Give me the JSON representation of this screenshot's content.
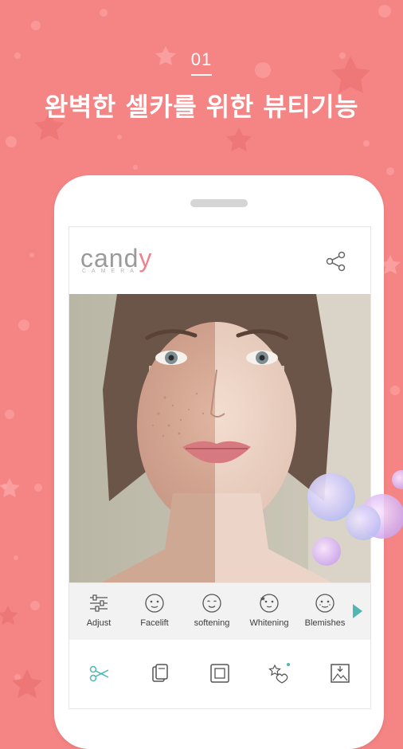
{
  "header": {
    "step": "01",
    "headline": "완벽한 셀카를 위한 뷰티기능"
  },
  "app": {
    "logo_main_prefix": "cand",
    "logo_main_suffix": "y",
    "logo_sub": "CAMERA"
  },
  "filters": [
    {
      "label": "Adjust",
      "icon": "sliders-icon"
    },
    {
      "label": "Facelift",
      "icon": "face-icon"
    },
    {
      "label": "softening",
      "icon": "face-icon"
    },
    {
      "label": "Whitening",
      "icon": "face-icon"
    },
    {
      "label": "Blemishes",
      "icon": "face-icon"
    }
  ],
  "toolbar": [
    {
      "icon": "scissors-icon"
    },
    {
      "icon": "sticker-frame-icon"
    },
    {
      "icon": "square-frame-icon"
    },
    {
      "icon": "decorate-stars-icon"
    },
    {
      "icon": "save-image-icon"
    }
  ],
  "colors": {
    "background": "#f58585",
    "accent_teal": "#4fb6b1",
    "logo_accent": "#f27f8d"
  }
}
